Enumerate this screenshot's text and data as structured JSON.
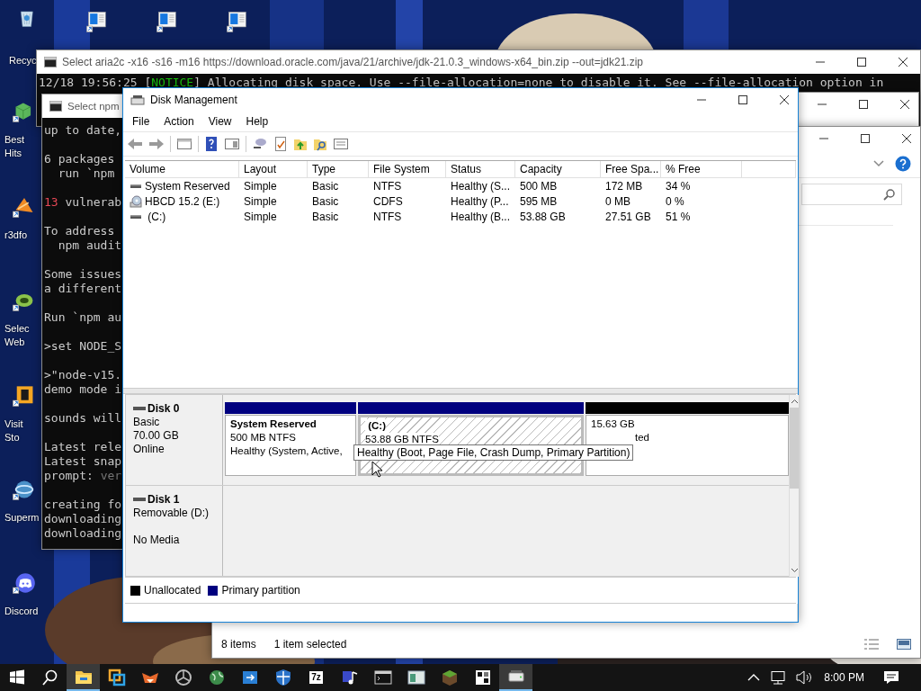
{
  "desktop": {
    "icons": [
      {
        "kind": "recycle-bin",
        "label": "Recyc",
        "shortcut": false
      },
      {
        "kind": "document",
        "shortcut": true
      },
      {
        "kind": "document",
        "shortcut": true
      },
      {
        "kind": "document",
        "shortcut": true
      },
      {
        "kind": "cube",
        "label": "Best\nHits",
        "shortcut": true
      },
      {
        "kind": "cone",
        "label": "r3dfo",
        "shortcut": true
      },
      {
        "kind": "ring",
        "label": "Selec\nWeb",
        "shortcut": true
      },
      {
        "kind": "tile",
        "label": "Visit\nSto",
        "shortcut": true
      },
      {
        "kind": "globe",
        "label": "Superm",
        "shortcut": true
      },
      {
        "kind": "chat",
        "label": "Discord",
        "shortcut": true
      }
    ]
  },
  "download_console": {
    "title": "Select aria2c  -x16 -s16 -m16 https://download.oracle.com/java/21/archive/jdk-21.0.3_windows-x64_bin.zip --out=jdk21.zip",
    "line": [
      {
        "text": "12/18 19:56:25 ["
      },
      {
        "text": "NOTICE",
        "color": "#16c60c"
      },
      {
        "text": "] Allocating disk space. Use --file-allocation=none to disable it. See --file-allocation option in"
      }
    ]
  },
  "npm_console": {
    "title": "Select npm",
    "lines": [
      {
        "parts": [
          {
            "text": "up to date,"
          }
        ]
      },
      {
        "blank_before": true,
        "parts": [
          {
            "text": "6 packages"
          }
        ]
      },
      {
        "parts": [
          {
            "text": "  run `npm"
          }
        ]
      },
      {
        "blank_before": true,
        "parts": [
          {
            "text": "13",
            "color": "#e74856"
          },
          {
            "text": " vulnerab"
          }
        ]
      },
      {
        "blank_before": true,
        "parts": [
          {
            "text": "To address"
          }
        ]
      },
      {
        "parts": [
          {
            "text": "  npm audit"
          }
        ]
      },
      {
        "blank_before": true,
        "parts": [
          {
            "text": "Some issues"
          }
        ]
      },
      {
        "parts": [
          {
            "text": "a different"
          }
        ]
      },
      {
        "blank_before": true,
        "parts": [
          {
            "text": "Run `npm au"
          }
        ]
      },
      {
        "blank_before": true,
        "parts": [
          {
            "text": ">set NODE_S"
          }
        ]
      },
      {
        "blank_before": true,
        "parts": [
          {
            "text": ">\"node-v15."
          }
        ]
      },
      {
        "parts": [
          {
            "text": "demo mode i"
          }
        ]
      },
      {
        "blank_before": true,
        "parts": [
          {
            "text": "sounds will"
          }
        ]
      },
      {
        "blank_before": true,
        "parts": [
          {
            "text": "Latest rele"
          }
        ]
      },
      {
        "parts": [
          {
            "text": "Latest snap"
          }
        ]
      },
      {
        "parts": [
          {
            "text": "prompt: "
          },
          {
            "text": "ver",
            "color": "#767676"
          }
        ]
      },
      {
        "blank_before": true,
        "parts": [
          {
            "text": "creating fo"
          }
        ]
      },
      {
        "parts": [
          {
            "text": "downloading"
          }
        ]
      },
      {
        "parts": [
          {
            "text": "downloading"
          }
        ]
      }
    ]
  },
  "explorer": {
    "status": [
      "8 items",
      "1 item selected"
    ]
  },
  "disk_management": {
    "title": "Disk Management",
    "menu": [
      "File",
      "Action",
      "View",
      "Help"
    ],
    "columns": [
      "Volume",
      "Layout",
      "Type",
      "File System",
      "Status",
      "Capacity",
      "Free Spa...",
      "% Free"
    ],
    "volumes": [
      {
        "kind": "disk",
        "cells": [
          "System Reserved",
          "Simple",
          "Basic",
          "NTFS",
          "Healthy (S...",
          "500 MB",
          "172 MB",
          "34 %"
        ]
      },
      {
        "kind": "cd",
        "cells": [
          "HBCD 15.2 (E:)",
          "Simple",
          "Basic",
          "CDFS",
          "Healthy (P...",
          "595 MB",
          "0 MB",
          "0 %"
        ]
      },
      {
        "kind": "disk",
        "cells": [
          " (C:)",
          "Simple",
          "Basic",
          "NTFS",
          "Healthy (B...",
          "53.88 GB",
          "27.51 GB",
          "51 %"
        ]
      }
    ],
    "disks": [
      {
        "name": "Disk 0",
        "lines": [
          "Basic",
          "70.00 GB"
        ],
        "status": "Online",
        "partitions": [
          {
            "name": "System Reserved",
            "size": "500 MB NTFS",
            "status": "Healthy (System, Active,",
            "color": "#00007f",
            "selected": false
          },
          {
            "name": " (C:)",
            "size": "53.88 GB NTFS",
            "color": "#00007f",
            "selected": true
          },
          {
            "size": "15.63 GB",
            "status": "ted",
            "color": "#000000",
            "selected": false
          }
        ]
      },
      {
        "name": "Disk 1",
        "lines": [
          "Removable (D:)"
        ],
        "status": "No Media"
      }
    ],
    "legend": [
      {
        "label": "Unallocated",
        "color": "#000000"
      },
      {
        "label": "Primary partition",
        "color": "#00007f"
      }
    ],
    "tooltip": "Healthy (Boot, Page File, Crash Dump, Primary Partition)"
  },
  "taskbar": {
    "items": [
      {
        "kind": "start",
        "selected": false
      },
      {
        "kind": "search",
        "selected": false
      },
      {
        "kind": "folder",
        "selected": true
      },
      {
        "kind": "squares",
        "selected": false
      },
      {
        "kind": "fox",
        "selected": false
      },
      {
        "kind": "aperture",
        "selected": false
      },
      {
        "kind": "globe",
        "selected": false
      },
      {
        "kind": "arrow-panel",
        "selected": false
      },
      {
        "kind": "shield",
        "selected": false
      },
      {
        "kind": "archive",
        "label": "7z",
        "selected": false
      },
      {
        "kind": "music",
        "selected": false
      },
      {
        "kind": "console",
        "selected": false
      },
      {
        "kind": "window",
        "selected": false
      },
      {
        "kind": "block",
        "selected": false
      },
      {
        "kind": "puzzle",
        "selected": false
      },
      {
        "kind": "drive",
        "selected": true
      }
    ],
    "clock": "8:00 PM"
  }
}
